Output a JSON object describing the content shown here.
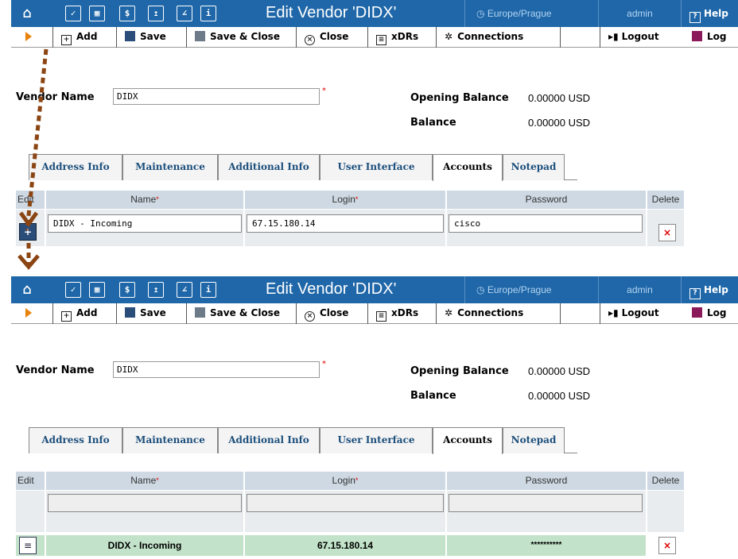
{
  "header": {
    "title": "Edit Vendor 'DIDX'",
    "timezone": "Europe/Prague",
    "user": "admin",
    "help_label": "Help",
    "nav_icons": [
      "home-icon",
      "checkbox-icon",
      "grid-icon",
      "dollar-icon",
      "export-icon",
      "chart-icon",
      "info-icon"
    ]
  },
  "toolbar": {
    "add": "Add",
    "save": "Save",
    "save_close": "Save & Close",
    "close": "Close",
    "xdrs": "xDRs",
    "connections": "Connections",
    "logout": "Logout",
    "log": "Log"
  },
  "vendor": {
    "name_label": "Vendor Name",
    "name_value": "DIDX",
    "opening_balance_label": "Opening Balance",
    "opening_balance_value": "0.00000 USD",
    "balance_label": "Balance",
    "balance_value": "0.00000 USD"
  },
  "tabs": [
    "Address Info",
    "Maintenance",
    "Additional Info",
    "User Interface",
    "Accounts",
    "Notepad"
  ],
  "accounts_table": {
    "headers": {
      "edit": "Edit",
      "name": "Name",
      "login": "Login",
      "password": "Password",
      "delete": "Delete"
    },
    "editing_row": {
      "name": "DIDX - Incoming",
      "login": "67.15.180.14",
      "password": "cisco"
    },
    "saved_row": {
      "name": "DIDX - Incoming",
      "login": "67.15.180.14",
      "password": "**********"
    }
  },
  "colors": {
    "header_bg": "#1f67a8",
    "tab_header": "#ced9e3",
    "saved_row": "#c2e3c9",
    "arrow": "#8b4513"
  }
}
